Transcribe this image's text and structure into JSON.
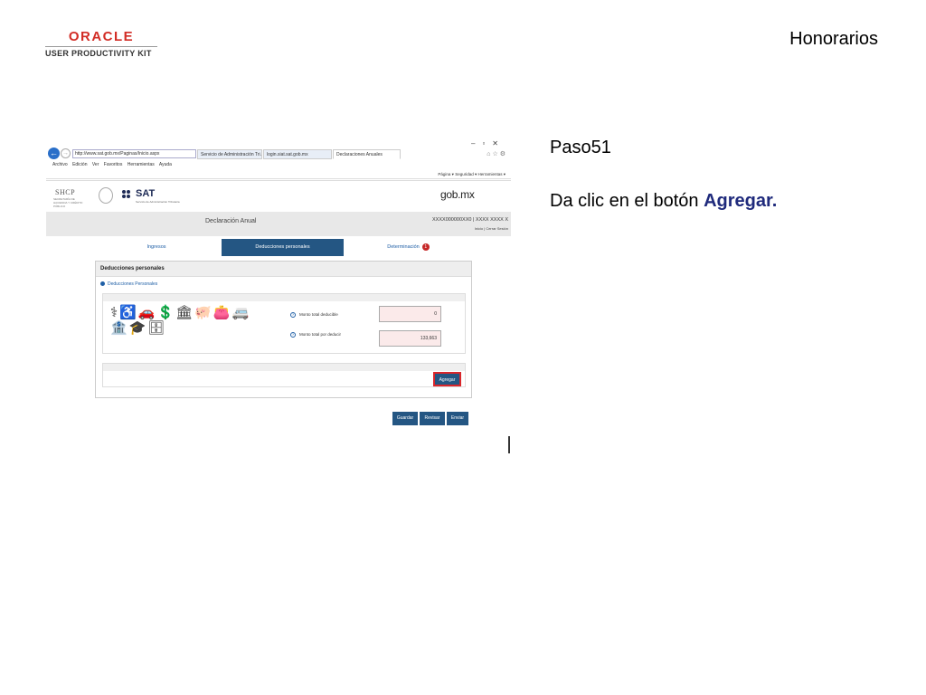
{
  "header": {
    "logo_word": "ORACLE",
    "logo_sub": "USER PRODUCTIVITY KIT",
    "title": "Honorarios"
  },
  "instruction": {
    "step": "Paso51",
    "text_prefix": "Da clic en el botón ",
    "text_strong": "Agregar."
  },
  "browser": {
    "url": "http://www.sat.gob.mx/Paginas/Inicio.aspx",
    "tabs": [
      "Servicio de Administración Tri...",
      "login.siat.sat.gob.mx",
      "Declaraciones Anuales"
    ],
    "menu": [
      "Archivo",
      "Edición",
      "Ver",
      "Favoritos",
      "Herramientas",
      "Ayuda"
    ],
    "command_bar": "Página ▾  Seguridad ▾  Herramientas ▾"
  },
  "site": {
    "shcp": "SHCP",
    "shcp_sub": "SECRETARÍA DE HACIENDA Y CRÉDITO PÚBLICO",
    "sat": "SAT",
    "sat_full": "Servicio de Administración Tributaria",
    "gob": "gob.mx",
    "page_title": "Declaración Anual",
    "rfc": "XXXX000000XX0 | XXXX XXXX X",
    "links": "Inicio | Cerrar Sesión"
  },
  "steps": [
    {
      "label": "Ingresos",
      "active": false
    },
    {
      "label": "Deducciones personales",
      "active": true
    },
    {
      "label": "Determinación",
      "active": false,
      "badge": "1"
    }
  ],
  "panel": {
    "title": "Deducciones personales",
    "subtitle": "Deducciones Personales",
    "field1_label": "Monto total deducible",
    "field1_value": "0",
    "field2_label": "Monto total por deducir",
    "field2_value": "133,663",
    "add_button": "Agregar"
  },
  "buttons": {
    "save": "Guardar",
    "review": "Revisar",
    "send": "Enviar"
  }
}
